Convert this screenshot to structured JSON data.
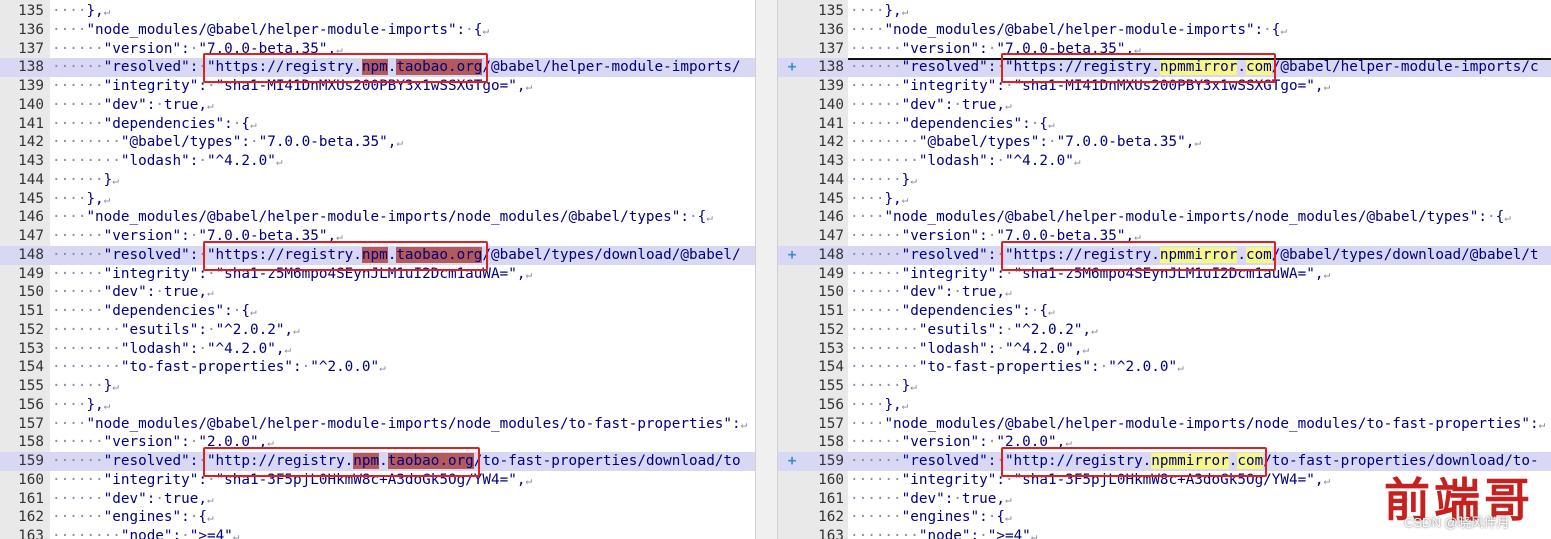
{
  "left": {
    "lines": [
      {
        "num": "135",
        "code": "····},",
        "changed": false
      },
      {
        "num": "136",
        "code": "····\"node_modules/@babel/helper-module-imports\":·{",
        "changed": false
      },
      {
        "num": "137",
        "code": "······\"version\":·\"7.0.0-beta.35\",",
        "changed": false
      },
      {
        "num": "138",
        "code": "······\"resolved\":·",
        "url": "\"https://registry.",
        "h1": "npm",
        ".": ".",
        "h2": "taobao.org",
        "rest": "/@babel/helper-module-imports/",
        "changed": true
      },
      {
        "num": "139",
        "code": "······\"integrity\":·\"sha1-MI41DnMXUs200PBY3x1wSSXGTgo=\",",
        "changed": false
      },
      {
        "num": "140",
        "code": "······\"dev\":·true,",
        "changed": false
      },
      {
        "num": "141",
        "code": "······\"dependencies\":·{",
        "changed": false
      },
      {
        "num": "142",
        "code": "········\"@babel/types\":·\"7.0.0-beta.35\",",
        "changed": false
      },
      {
        "num": "143",
        "code": "········\"lodash\":·\"^4.2.0\"",
        "changed": false
      },
      {
        "num": "144",
        "code": "······}",
        "changed": false
      },
      {
        "num": "145",
        "code": "····},",
        "changed": false
      },
      {
        "num": "146",
        "code": "····\"node_modules/@babel/helper-module-imports/node_modules/@babel/types\":·{",
        "changed": false
      },
      {
        "num": "147",
        "code": "······\"version\":·\"7.0.0-beta.35\",",
        "changed": false
      },
      {
        "num": "148",
        "code": "······\"resolved\":·",
        "url": "\"https://registry.",
        "h1": "npm",
        ".": ".",
        "h2": "taobao.org",
        "rest": "/@babel/types/download/@babel/",
        "changed": true
      },
      {
        "num": "149",
        "code": "······\"integrity\":·\"sha1-z5M6mpo4SEynJLM1uI2Dcm1auWA=\",",
        "changed": false
      },
      {
        "num": "150",
        "code": "······\"dev\":·true,",
        "changed": false
      },
      {
        "num": "151",
        "code": "······\"dependencies\":·{",
        "changed": false
      },
      {
        "num": "152",
        "code": "········\"esutils\":·\"^2.0.2\",",
        "changed": false
      },
      {
        "num": "153",
        "code": "········\"lodash\":·\"^4.2.0\",",
        "changed": false
      },
      {
        "num": "154",
        "code": "········\"to-fast-properties\":·\"^2.0.0\"",
        "changed": false
      },
      {
        "num": "155",
        "code": "······}",
        "changed": false
      },
      {
        "num": "156",
        "code": "····},",
        "changed": false
      },
      {
        "num": "157",
        "code": "····\"node_modules/@babel/helper-module-imports/node_modules/to-fast-properties\":",
        "changed": false
      },
      {
        "num": "158",
        "code": "······\"version\":·\"2.0.0\",",
        "changed": false
      },
      {
        "num": "159",
        "code": "······\"resolved\":·",
        "url": "\"http://registry.",
        "h1": "npm",
        ".": ".",
        "h2": "taobao.org",
        "rest": "/to-fast-properties/download/to",
        "changed": true
      },
      {
        "num": "160",
        "code": "······\"integrity\":·\"sha1-3F5pjL0HkmW8c+A3doGk5Og/YW4=\",",
        "changed": false
      },
      {
        "num": "161",
        "code": "······\"dev\":·true,",
        "changed": false
      },
      {
        "num": "162",
        "code": "······\"engines\":·{",
        "changed": false
      },
      {
        "num": "163",
        "code": "········\"node\":·\">=4\"",
        "changed": false
      }
    ]
  },
  "right": {
    "lines": [
      {
        "num": "135",
        "code": "····},",
        "changed": false
      },
      {
        "num": "136",
        "code": "····\"node_modules/@babel/helper-module-imports\":·{",
        "changed": false
      },
      {
        "num": "137",
        "code": "······\"version\":·\"7.0.0-beta.35\",",
        "changed": false
      },
      {
        "num": "138",
        "code": "······\"resolved\":·",
        "url": "\"https://registry.",
        "h1": "npmmirror",
        ".": ".",
        "h2": "com",
        "rest": "/@babel/helper-module-imports/c",
        "changed": true,
        "marker": "+"
      },
      {
        "num": "139",
        "code": "······\"integrity\":·\"sha1-MI41DnMXUs200PBY3x1wSSXGTgo=\",",
        "changed": false
      },
      {
        "num": "140",
        "code": "······\"dev\":·true,",
        "changed": false
      },
      {
        "num": "141",
        "code": "······\"dependencies\":·{",
        "changed": false
      },
      {
        "num": "142",
        "code": "········\"@babel/types\":·\"7.0.0-beta.35\",",
        "changed": false
      },
      {
        "num": "143",
        "code": "········\"lodash\":·\"^4.2.0\"",
        "changed": false
      },
      {
        "num": "144",
        "code": "······}",
        "changed": false
      },
      {
        "num": "145",
        "code": "····},",
        "changed": false
      },
      {
        "num": "146",
        "code": "····\"node_modules/@babel/helper-module-imports/node_modules/@babel/types\":·{",
        "changed": false
      },
      {
        "num": "147",
        "code": "······\"version\":·\"7.0.0-beta.35\",",
        "changed": false
      },
      {
        "num": "148",
        "code": "······\"resolved\":·",
        "url": "\"https://registry.",
        "h1": "npmmirror",
        ".": ".",
        "h2": "com",
        "rest": "/@babel/types/download/@babel/t",
        "changed": true,
        "marker": "+"
      },
      {
        "num": "149",
        "code": "······\"integrity\":·\"sha1-z5M6mpo4SEynJLM1uI2Dcm1auWA=\",",
        "changed": false
      },
      {
        "num": "150",
        "code": "······\"dev\":·true,",
        "changed": false
      },
      {
        "num": "151",
        "code": "······\"dependencies\":·{",
        "changed": false
      },
      {
        "num": "152",
        "code": "········\"esutils\":·\"^2.0.2\",",
        "changed": false
      },
      {
        "num": "153",
        "code": "········\"lodash\":·\"^4.2.0\",",
        "changed": false
      },
      {
        "num": "154",
        "code": "········\"to-fast-properties\":·\"^2.0.0\"",
        "changed": false
      },
      {
        "num": "155",
        "code": "······}",
        "changed": false
      },
      {
        "num": "156",
        "code": "····},",
        "changed": false
      },
      {
        "num": "157",
        "code": "····\"node_modules/@babel/helper-module-imports/node_modules/to-fast-properties\":",
        "changed": false
      },
      {
        "num": "158",
        "code": "······\"version\":·\"2.0.0\",",
        "changed": false
      },
      {
        "num": "159",
        "code": "······\"resolved\":·",
        "url": "\"http://registry.",
        "h1": "npmmirror",
        ".": ".",
        "h2": "com",
        "rest": "/to-fast-properties/download/to-",
        "changed": true,
        "marker": "+"
      },
      {
        "num": "160",
        "code": "······\"integrity\":·\"sha1-3F5pjL0HkmW8c+A3doGk5Og/YW4=\",",
        "changed": false
      },
      {
        "num": "161",
        "code": "······\"dev\":·true,",
        "changed": false
      },
      {
        "num": "162",
        "code": "······\"engines\":·{",
        "changed": false
      },
      {
        "num": "163",
        "code": "········\"node\":·\">=4\"",
        "changed": false
      }
    ]
  },
  "eol_glyph": "↵",
  "watermark": "前端哥",
  "csdn_label": "CSDN @晓风伴月",
  "colors": {
    "old_highlight": "#b45a5a",
    "new_highlight": "#f7f784",
    "changed_row": "#d8d8f4",
    "annotation_box": "#e02020"
  }
}
